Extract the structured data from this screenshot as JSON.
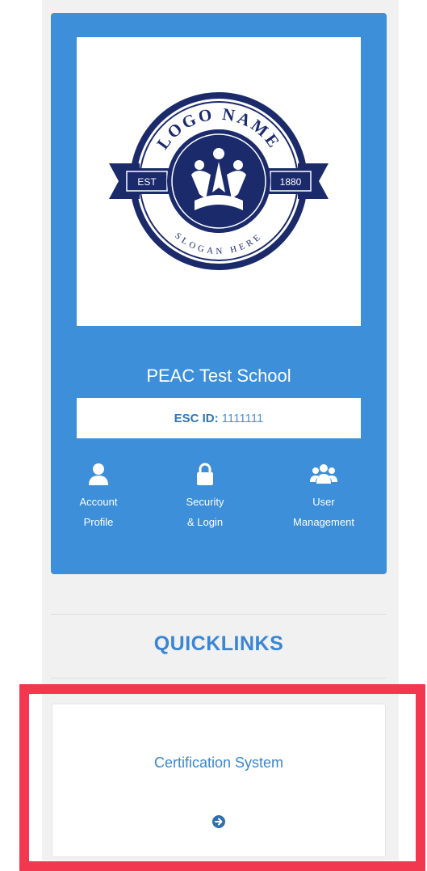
{
  "profile": {
    "logo": {
      "top_text": "LOGO NAME",
      "bottom_text": "SLOGAN HERE",
      "ribbon_left": "EST",
      "ribbon_right": "1880"
    },
    "school_name": "PEAC Test School",
    "esc_label": "ESC ID:",
    "esc_value": "1111111",
    "actions": [
      {
        "line1": "Account",
        "line2": "Profile",
        "icon": "user-icon"
      },
      {
        "line1": "Security",
        "line2": "& Login",
        "icon": "lock-icon"
      },
      {
        "line1": "User",
        "line2": "Management",
        "icon": "users-icon"
      }
    ]
  },
  "quicklinks": {
    "title": "QUICKLINKS",
    "items": [
      {
        "label": "Certification System",
        "icon": "arrow-circle-right-icon"
      }
    ]
  },
  "colors": {
    "card_blue": "#3c8fd8",
    "link_blue": "#3a86cc",
    "highlight_red": "#f1384f",
    "logo_navy": "#1b2a6b"
  }
}
